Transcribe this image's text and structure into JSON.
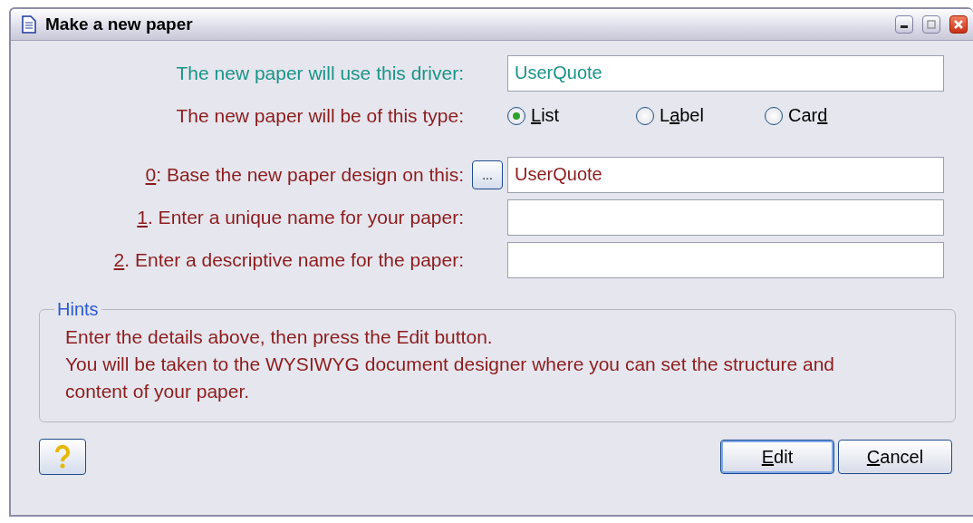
{
  "window": {
    "title": "Make a new paper"
  },
  "driver": {
    "label": "The new paper will use this driver:",
    "value": "UserQuote"
  },
  "type": {
    "label": "The new paper will be of this type:",
    "options": [
      {
        "key": "L",
        "post": "ist",
        "selected": true
      },
      {
        "pre": "L",
        "key": "a",
        "post": "bel",
        "selected": false
      },
      {
        "pre": "Car",
        "key": "d",
        "selected": false
      }
    ]
  },
  "fields": [
    {
      "key": "0",
      "post": ": Base the new paper design on this:",
      "value": "UserQuote",
      "browse": "..."
    },
    {
      "key": "1",
      "post": ". Enter a unique name for your paper:"
    },
    {
      "key": "2",
      "post": ". Enter a descriptive name for the paper:"
    }
  ],
  "hints": {
    "title": "Hints",
    "lines": [
      "Enter the details above, then press the Edit button.",
      "You will be taken to the WYSIWYG document designer where you can set the structure and content of your paper."
    ]
  },
  "buttons": [
    {
      "key": "E",
      "post": "dit"
    },
    {
      "key": "C",
      "post": "ancel"
    }
  ]
}
